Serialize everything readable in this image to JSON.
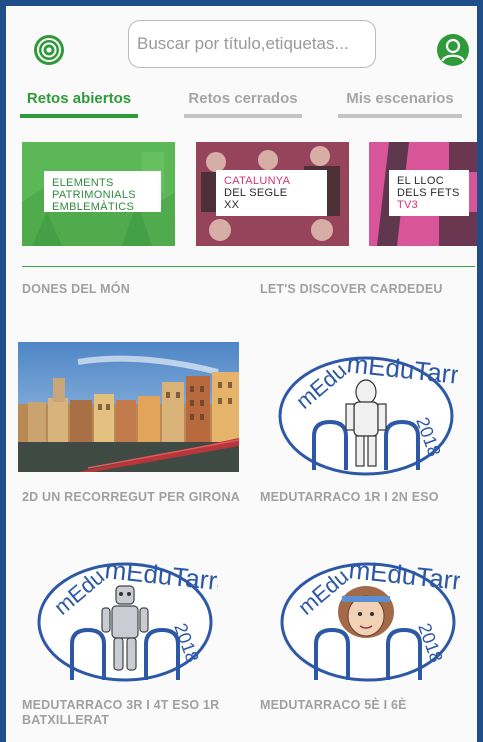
{
  "header": {
    "search_placeholder": "Buscar por título,etiquetas...",
    "app_icon": "target-radar-icon",
    "user_icon": "user-profile-icon",
    "accent_color": "#2f9a3a"
  },
  "tabs": [
    {
      "label": "Retos abiertos",
      "active": true
    },
    {
      "label": "Retos cerrados",
      "active": false
    },
    {
      "label": "Mis escenarios",
      "active": false
    }
  ],
  "carousel": [
    {
      "lines": [
        "ELEMENTS",
        "PATRIMONIALS",
        "EMBLEMÀTICS"
      ]
    },
    {
      "lines": [
        "CATALUNYA",
        "DEL SEGLE",
        "XX"
      ]
    },
    {
      "lines": [
        "EL LLOC",
        "DELS FETS",
        "TV3"
      ]
    }
  ],
  "scenarios": [
    {
      "title": "DONES DEL MÓN"
    },
    {
      "title": "LET'S DISCOVER CARDEDEU"
    },
    {
      "title": "2D UN RECORREGUT PER GIRONA"
    },
    {
      "title": "MEDUTARRACO 1R I 2N ESO"
    },
    {
      "title": "MEDUTARRACO 3R I 4T ESO 1R BATXILLERAT"
    },
    {
      "title": "MEDUTARRACO 5È I 6È"
    }
  ],
  "logo": {
    "word": "mEduTarraco",
    "year": "2018"
  }
}
